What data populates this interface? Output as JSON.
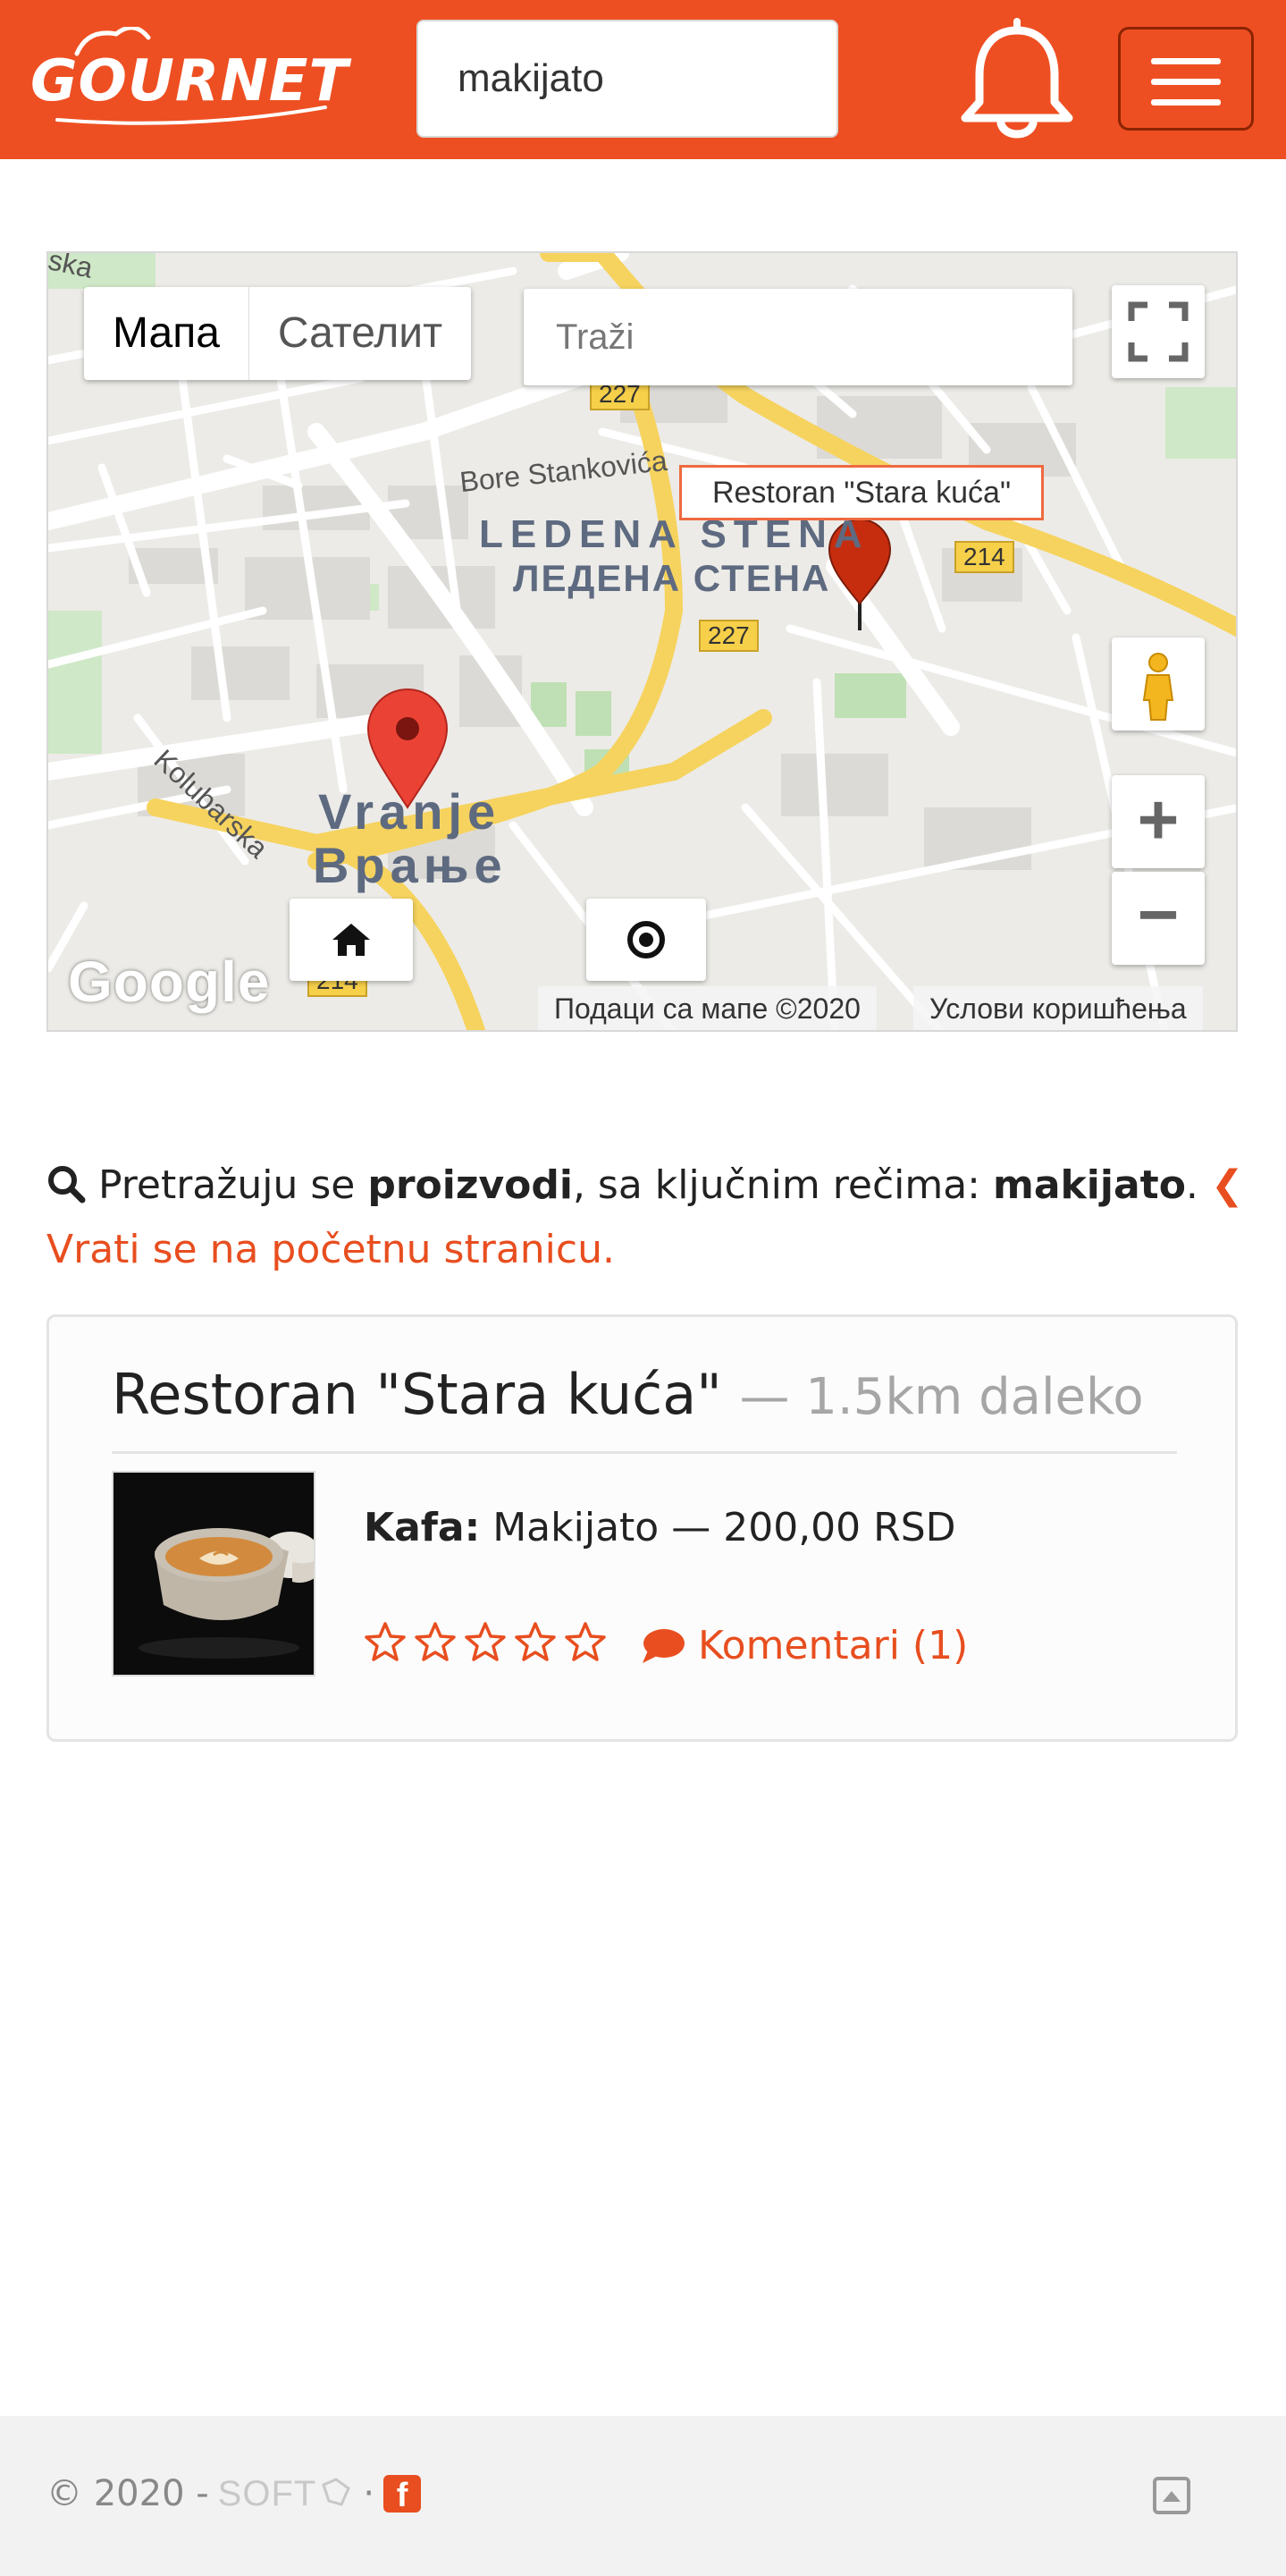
{
  "header": {
    "logo_text": "GOURNET",
    "search_value": "makijato"
  },
  "map": {
    "type_map": "Мапа",
    "type_satellite": "Сателит",
    "search_placeholder": "Traži",
    "marker_label": "Restoran \"Stara kuća\"",
    "attribution_data": "Подаци са мапе ©2020",
    "attribution_terms": "Услови коришћења",
    "google_logo": "Google",
    "labels": {
      "district_latin": "LEDENA STENA",
      "district_cyr": "ЛЕДЕНА СТЕНА",
      "city_latin": "Vranje",
      "city_cyr": "Врање",
      "street_bore": "Bore Stankovića",
      "street_kolubarska": "Kolubarska",
      "street_ska": "ska",
      "road_227a": "227",
      "road_227b": "227",
      "road_214a": "214",
      "road_214b": "214"
    }
  },
  "summary": {
    "prefix": "Pretražuju se ",
    "category": "proizvodi",
    "middle": ", sa ključnim rečima: ",
    "keyword": "makijato",
    "period": ".",
    "back_link": "Vrati se na početnu stranicu."
  },
  "result": {
    "restaurant": "Restoran \"Stara kuća\"",
    "distance": "— 1.5km daleko",
    "category_label": "Kafa:",
    "product": "Makijato",
    "price": "— 200,00 RSD",
    "rating": 0,
    "rating_max": 5,
    "comments_label": "Komentari (1)"
  },
  "footer": {
    "copyright": "© 2020 -",
    "brand": "SOFT",
    "separator": "·"
  },
  "colors": {
    "brand": "#ee4f22",
    "accent": "#e84e1f"
  }
}
